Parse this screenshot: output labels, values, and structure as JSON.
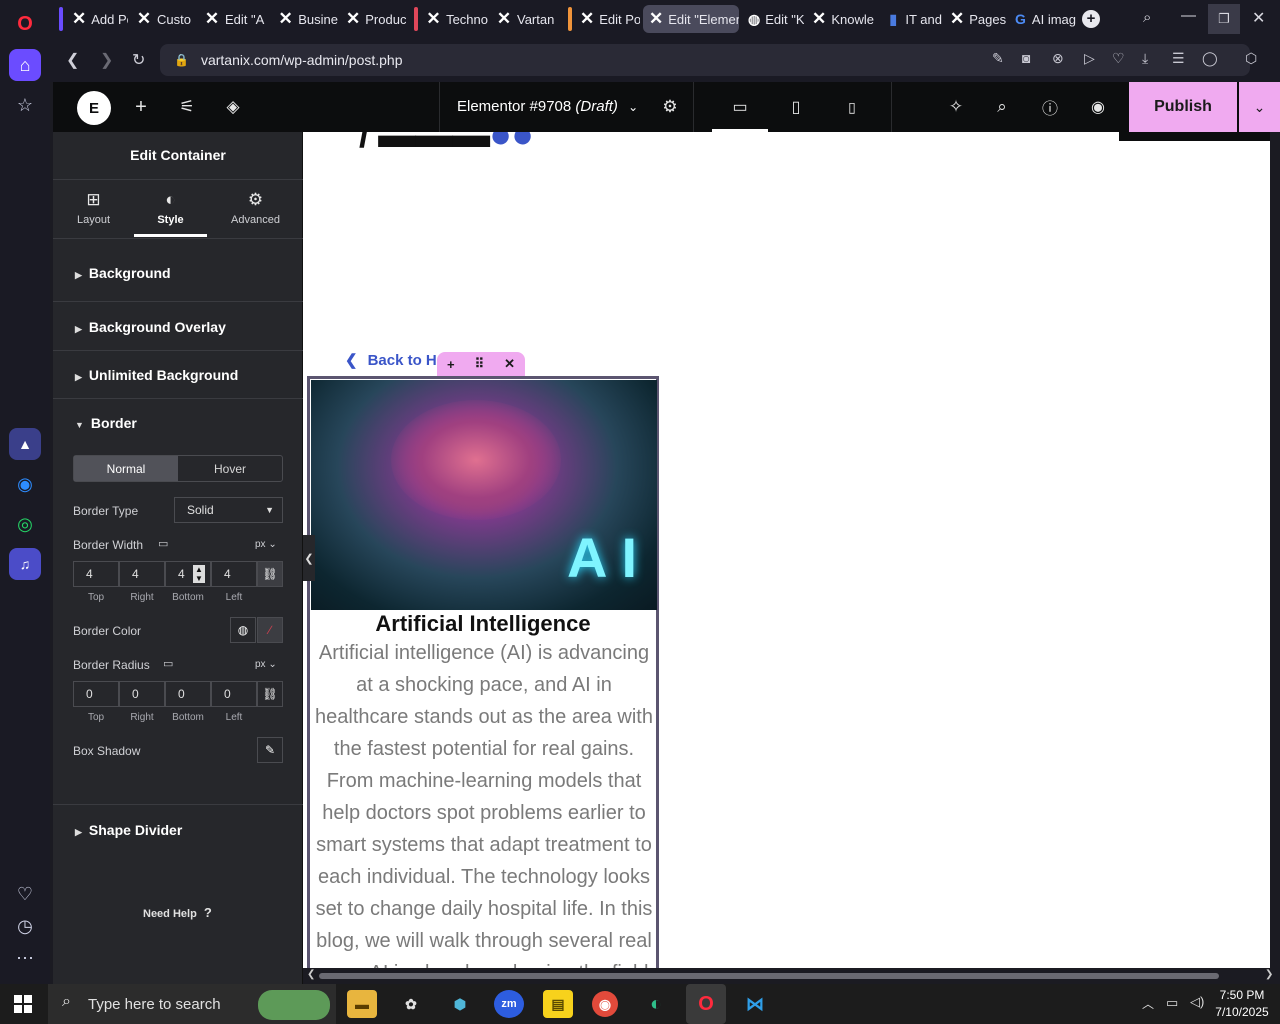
{
  "browser": {
    "tabs": [
      {
        "label": "Add Po",
        "icon": "x-logo-icon"
      },
      {
        "label": "Custo",
        "icon": "x-logo-icon"
      },
      {
        "label": "Edit \"A",
        "icon": "x-logo-icon"
      },
      {
        "label": "Busine",
        "icon": "x-logo-icon"
      },
      {
        "label": "Produc",
        "icon": "x-logo-icon"
      },
      {
        "label": "Techno",
        "icon": "x-logo-icon"
      },
      {
        "label": "Vartan",
        "icon": "x-logo-icon"
      },
      {
        "label": "Edit Po",
        "icon": "x-logo-icon"
      },
      {
        "label": "Edit \"Elemen",
        "icon": "x-logo-icon"
      },
      {
        "label": "Edit \"K",
        "icon": "globe-icon"
      },
      {
        "label": "Knowle",
        "icon": "x-logo-icon"
      },
      {
        "label": "IT and",
        "icon": "book-icon"
      },
      {
        "label": "Pages",
        "icon": "x-logo-icon"
      },
      {
        "label": "AI imag",
        "icon": "google-icon"
      }
    ],
    "group_colors": [
      "#6a4cff",
      "#e0475a",
      "#f0943b"
    ],
    "url": "vartanix.com/wp-admin/post.php"
  },
  "elementor": {
    "doc_title": "Elementor #9708",
    "doc_status": "(Draft)",
    "publish_label": "Publish",
    "accent": "#f0aaf0"
  },
  "panel": {
    "title": "Edit Container",
    "tabs": [
      "Layout",
      "Style",
      "Advanced"
    ],
    "sections": [
      "Background",
      "Background Overlay",
      "Unlimited Background",
      "Border",
      "Shape Divider"
    ],
    "border": {
      "state_normal": "Normal",
      "state_hover": "Hover",
      "type_label": "Border Type",
      "type_value": "Solid",
      "width_label": "Border Width",
      "unit": "px",
      "width_values": [
        "4",
        "4",
        "4",
        "4"
      ],
      "side_labels": [
        "Top",
        "Right",
        "Bottom",
        "Left"
      ],
      "color_label": "Border Color",
      "radius_label": "Border Radius",
      "radius_values": [
        "0",
        "0",
        "0",
        "0"
      ],
      "shadow_label": "Box Shadow"
    },
    "help": "Need Help"
  },
  "canvas": {
    "back_link": "Back to Hor",
    "image_caption": "AI",
    "card_title": "Artificial Intelligence",
    "card_text": "Artificial intelligence (AI) is advancing at a shocking pace, and AI in healthcare stands out as the area with the fastest potential for real gains. From machine-learning models that help doctors spot problems earlier to smart systems that adapt treatment to each individual. The technology looks set to change daily hospital life. In this blog, we will walk through several real ways AI is already reshaping the field"
  },
  "taskbar": {
    "search_placeholder": "Type here to search",
    "time": "7:50 PM",
    "date": "7/10/2025"
  }
}
